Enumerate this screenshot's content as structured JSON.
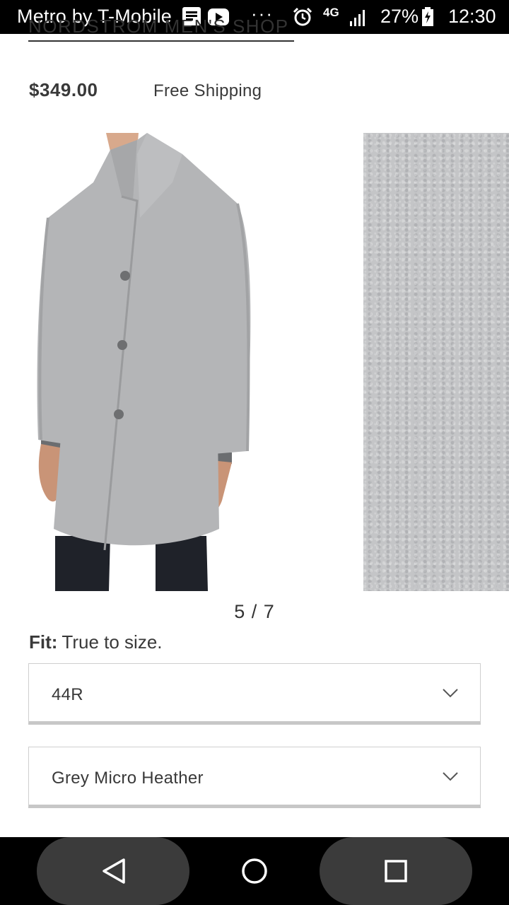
{
  "status_bar": {
    "carrier": "Metro by T-Mobile",
    "overflow": "···",
    "network": "4G",
    "battery": "27%",
    "time": "12:30",
    "icons": [
      "document-icon",
      "youtube-icon",
      "alarm-icon",
      "signal-icon",
      "battery-charging-icon"
    ]
  },
  "product": {
    "brand_link": "Nordstrom Men's Shop",
    "price": "$349.00",
    "shipping": "Free Shipping"
  },
  "gallery": {
    "counter": "5 / 7",
    "current": 5,
    "total": 7,
    "images": [
      "coat-model-image",
      "fabric-swatch-image"
    ]
  },
  "fit": {
    "label": "Fit:",
    "value": "True to size."
  },
  "selectors": {
    "size": "44R",
    "color": "Grey Micro Heather"
  },
  "nav_bar": {
    "icons": [
      "back-icon",
      "home-icon",
      "recent-apps-icon"
    ]
  },
  "colors": {
    "status_bar": "#000000",
    "nav_pill": "#3b3b3b",
    "coat_grey": "#b4b5b7",
    "swatch_grey": "#c4c5c7",
    "text": "#393939"
  }
}
